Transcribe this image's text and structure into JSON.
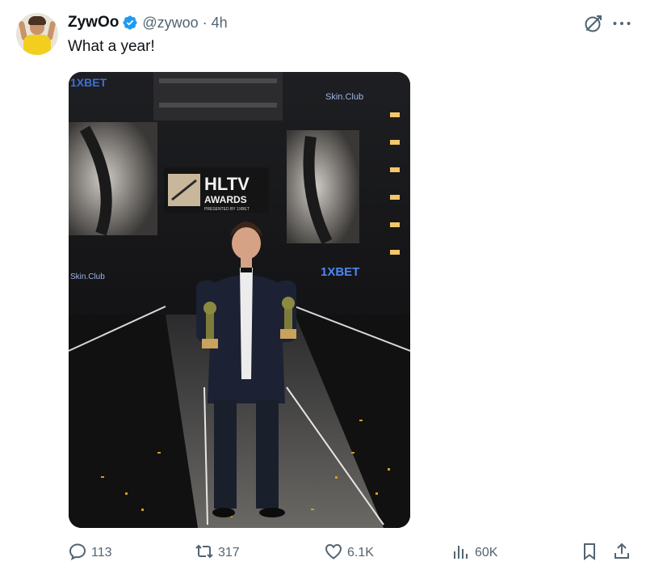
{
  "tweet": {
    "author": {
      "display_name": "ZywOo",
      "handle": "@zywoo",
      "verified": true,
      "avatar": "avatar-photo"
    },
    "separator": "·",
    "time": "4h",
    "text": "What a year!",
    "media": {
      "description": "HLTV Awards stage photo",
      "stage_texts": {
        "hltv": "HLTV",
        "awards": "AWARDS",
        "presented": "PRESENTED BY 1XBET",
        "sponsor_1xbet": "1XBET",
        "sponsor_skinclub": "Skin.Club"
      }
    },
    "icons": {
      "verified": "verified-badge-icon",
      "grok": "grok-icon",
      "more": "more-icon",
      "reply": "reply-icon",
      "retweet": "retweet-icon",
      "like": "heart-icon",
      "views": "views-icon",
      "bookmark": "bookmark-icon",
      "share": "share-icon"
    },
    "stats": {
      "replies": "113",
      "retweets": "317",
      "likes": "6.1K",
      "views": "60K"
    },
    "colors": {
      "text_primary": "#0f1419",
      "text_secondary": "#536471",
      "verified_blue": "#1d9bf0"
    }
  }
}
